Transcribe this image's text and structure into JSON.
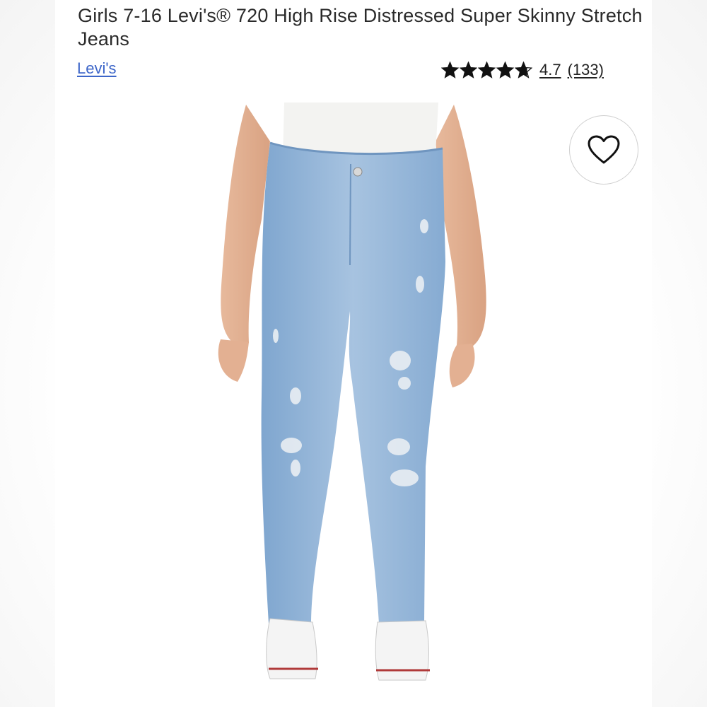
{
  "product": {
    "title": "Girls 7-16 Levi's® 720 High Rise Distressed Super Skinny Stretch Jeans",
    "brand": "Levi's",
    "rating": {
      "value": 4.7,
      "value_text": "4.7",
      "count_text": "(133)",
      "stars_max": 5
    },
    "image": {
      "icon": "product-photo-jeans"
    },
    "wishlist_icon": "heart-outline-icon"
  },
  "colors": {
    "brand_link": "#3d66c9",
    "stars": "#111111",
    "denim": "#8fb3d6"
  }
}
